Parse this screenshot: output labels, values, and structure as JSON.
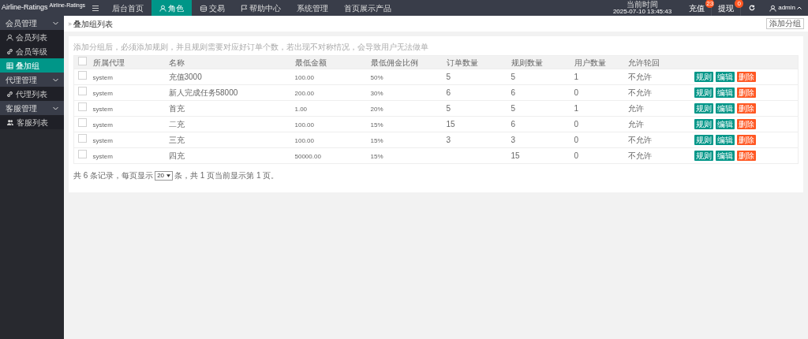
{
  "logo": {
    "title": "Airline-Ratings",
    "subtitle": "Airline-Ratings"
  },
  "top_nav": [
    {
      "label": "后台首页",
      "kind": "plain",
      "selected": false
    },
    {
      "label": "角色",
      "kind": "user",
      "selected": true
    },
    {
      "label": "交易",
      "kind": "coins",
      "selected": false
    },
    {
      "label": "帮助中心",
      "kind": "flag",
      "selected": false
    },
    {
      "label": "系统管理",
      "kind": "plain",
      "selected": false
    },
    {
      "label": "首页展示产品",
      "kind": "plain",
      "selected": false
    }
  ],
  "header_right": {
    "time_label": "当前时间",
    "time": "2025-07-10 13:45:43",
    "links": [
      {
        "label": "充值",
        "badge": "23"
      },
      {
        "label": "提现",
        "badge": "0"
      }
    ],
    "user": "admin"
  },
  "sidebar": [
    {
      "label": "会员管理",
      "expanded": true,
      "children": [
        {
          "label": "会员列表",
          "kind": "user",
          "selected": false
        },
        {
          "label": "会员等级",
          "kind": "link",
          "selected": false
        },
        {
          "label": "叠加组",
          "kind": "grid",
          "selected": true
        }
      ]
    },
    {
      "label": "代理管理",
      "expanded": true,
      "children": [
        {
          "label": "代理列表",
          "kind": "link",
          "selected": false
        }
      ]
    },
    {
      "label": "客服管理",
      "expanded": true,
      "children": [
        {
          "label": "客服列表",
          "kind": "users",
          "selected": false
        }
      ]
    }
  ],
  "breadcrumb": "叠加组列表",
  "add_button": "添加分组",
  "hint": "添加分组后，必须添加规则，并且规则需要对应好订单个数，若出现不对称情况，会导致用户无法做单",
  "table": {
    "header_checked": false,
    "columns": [
      "所属代理",
      "名称",
      "最低金额",
      "最低佣金比例",
      "订单数量",
      "规则数量",
      "用户数量",
      "允许轮回"
    ],
    "rows": [
      {
        "checked": false,
        "cells": [
          "system",
          "充值3000",
          "100.00",
          "50%",
          "5",
          "5",
          "1",
          "不允许"
        ],
        "actions": [
          {
            "label": "规则",
            "kind": "primary"
          },
          {
            "label": "编辑",
            "kind": "primary"
          },
          {
            "label": "删除",
            "kind": "danger"
          }
        ]
      },
      {
        "checked": false,
        "cells": [
          "system",
          "新人完成任务58000",
          "200.00",
          "30%",
          "6",
          "6",
          "0",
          "不允许"
        ],
        "actions": [
          {
            "label": "规则",
            "kind": "primary"
          },
          {
            "label": "编辑",
            "kind": "primary"
          },
          {
            "label": "删除",
            "kind": "danger"
          }
        ]
      },
      {
        "checked": false,
        "cells": [
          "system",
          "首充",
          "1.00",
          "20%",
          "5",
          "5",
          "1",
          "允许"
        ],
        "actions": [
          {
            "label": "规则",
            "kind": "primary"
          },
          {
            "label": "编辑",
            "kind": "primary"
          },
          {
            "label": "删除",
            "kind": "danger"
          }
        ]
      },
      {
        "checked": false,
        "cells": [
          "system",
          "二充",
          "100.00",
          "15%",
          "15",
          "6",
          "0",
          "允许"
        ],
        "actions": [
          {
            "label": "规则",
            "kind": "primary"
          },
          {
            "label": "编辑",
            "kind": "primary"
          },
          {
            "label": "删除",
            "kind": "danger"
          }
        ]
      },
      {
        "checked": false,
        "cells": [
          "system",
          "三充",
          "100.00",
          "15%",
          "3",
          "3",
          "0",
          "不允许"
        ],
        "actions": [
          {
            "label": "规则",
            "kind": "primary"
          },
          {
            "label": "编辑",
            "kind": "primary"
          },
          {
            "label": "删除",
            "kind": "danger"
          }
        ]
      },
      {
        "checked": false,
        "cells": [
          "system",
          "四充",
          "50000.00",
          "15%",
          null,
          "15",
          "0",
          "不允许"
        ],
        "actions": [
          {
            "label": "规则",
            "kind": "primary"
          },
          {
            "label": "编辑",
            "kind": "primary"
          },
          {
            "label": "删除",
            "kind": "danger"
          }
        ]
      }
    ]
  },
  "pager": {
    "before": "共 6 条记录，每页显示",
    "page_size": "20",
    "after": "条，共 1 页当前显示第 1 页。"
  }
}
